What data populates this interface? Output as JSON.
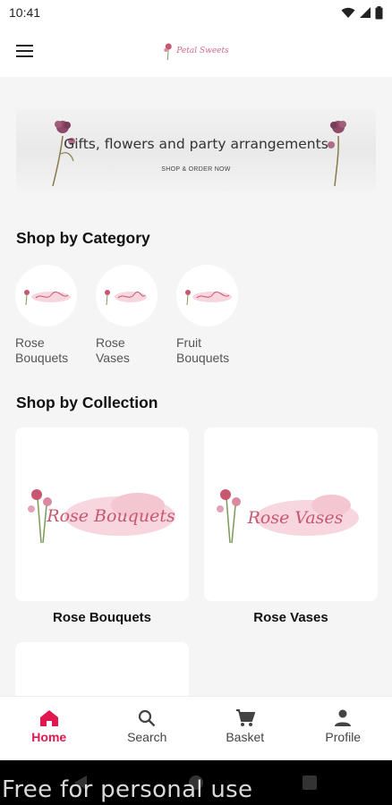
{
  "status_bar": {
    "time": "10:41"
  },
  "app_bar": {
    "logo_alt": "logo",
    "menu_icon": "menu-icon"
  },
  "banner": {
    "title": "Gifts, flowers and party arrangements",
    "subtitle": "SHOP & ORDER NOW"
  },
  "categories": {
    "title": "Shop by Category",
    "items": [
      {
        "label": "Rose\nBouquets"
      },
      {
        "label": "Rose\nVases"
      },
      {
        "label": "Fruit\nBouquets"
      }
    ]
  },
  "collections": {
    "title": "Shop by Collection",
    "items": [
      {
        "label": "Rose Bouquets",
        "image_text": "Rose Bouquets"
      },
      {
        "label": "Rose Vases",
        "image_text": "Rose Vases"
      }
    ]
  },
  "bottom_nav": {
    "items": [
      {
        "label": "Home",
        "icon": "home-icon",
        "active": true
      },
      {
        "label": "Search",
        "icon": "search-icon"
      },
      {
        "label": "Basket",
        "icon": "cart-icon"
      },
      {
        "label": "Profile",
        "icon": "person-icon"
      }
    ]
  },
  "watermark": "Free for personal use",
  "colors": {
    "accent": "#e0184f",
    "brand_pink": "#d26a8a"
  }
}
